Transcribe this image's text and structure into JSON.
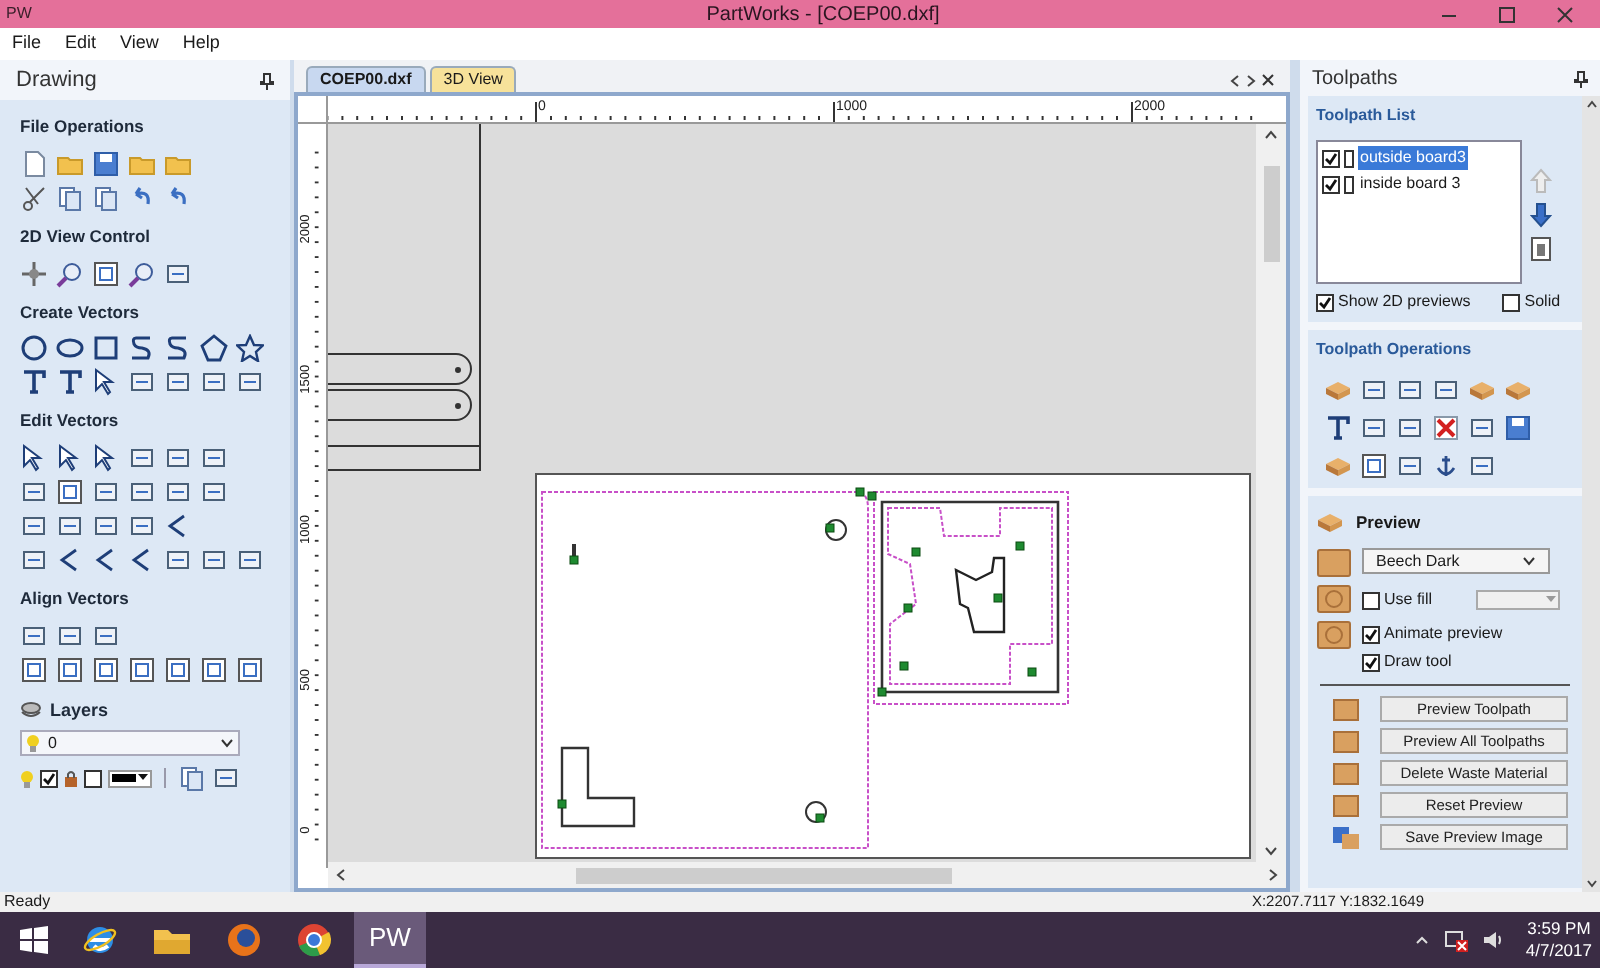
{
  "window": {
    "icon": "PW",
    "title": "PartWorks - [COEP00.dxf]"
  },
  "menu": [
    "File",
    "Edit",
    "View",
    "Help"
  ],
  "drawing_panel": {
    "title": "Drawing",
    "sections": [
      {
        "title": "File Operations"
      },
      {
        "title": "2D View Control"
      },
      {
        "title": "Create Vectors"
      },
      {
        "title": "Edit Vectors"
      },
      {
        "title": "Align Vectors"
      }
    ],
    "layers": {
      "title": "Layers",
      "current": "0",
      "visible": true,
      "locked": false
    }
  },
  "document_tabs": [
    {
      "label": "COEP00.dxf",
      "selected": true
    },
    {
      "label": "3D View",
      "selected": false
    }
  ],
  "rulers": {
    "horizontal": [
      "0",
      "1000",
      "2000"
    ],
    "vertical": [
      "2000",
      "1500",
      "1000",
      "500",
      "0"
    ]
  },
  "toolpaths_panel": {
    "title": "Toolpaths",
    "list_title": "Toolpath List",
    "toolpaths": [
      {
        "label": "outside board3",
        "checked": true,
        "selected": true
      },
      {
        "label": "inside board 3",
        "checked": true,
        "selected": false
      }
    ],
    "show_2d_previews": {
      "label": "Show 2D previews",
      "checked": true
    },
    "solid": {
      "label": "Solid",
      "checked": false
    },
    "operations_title": "Toolpath Operations",
    "preview": {
      "title": "Preview",
      "material": "Beech Dark",
      "options": [
        {
          "label": "Use fill",
          "checked": false
        },
        {
          "label": "Animate preview",
          "checked": true
        },
        {
          "label": "Draw tool",
          "checked": true
        }
      ],
      "buttons": [
        "Preview Toolpath",
        "Preview All Toolpaths",
        "Delete Waste Material",
        "Reset Preview",
        "Save Preview Image"
      ]
    }
  },
  "status_bar": {
    "message": "Ready",
    "coordinates": "X:2207.7117 Y:1832.1649"
  },
  "taskbar": {
    "active_app": "PW",
    "time": "3:59 PM",
    "date": "4/7/2017"
  }
}
